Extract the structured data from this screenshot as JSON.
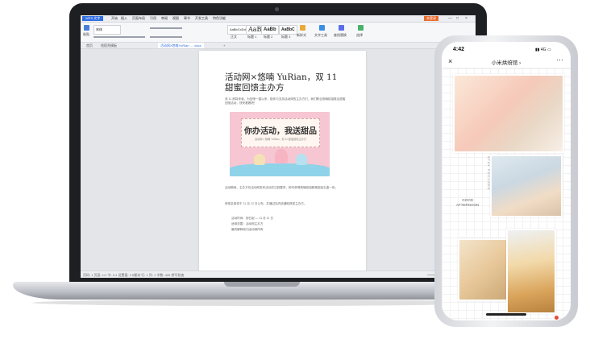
{
  "laptop": {
    "app_tab": "WPS 文字",
    "menu": [
      "开始",
      "插入",
      "页面布局",
      "引用",
      "审阅",
      "视图",
      "章节",
      "开发工具",
      "特色功能"
    ],
    "active_menu": "开始",
    "login": "未登录",
    "window_controls": [
      "—",
      "□",
      "×"
    ],
    "ribbon": {
      "paste": "粘贴",
      "font_name": "宋体",
      "styles": [
        {
          "sample": "AaBbCcDd",
          "label": "正文"
        },
        {
          "sample": "AaB",
          "label": "标题 1"
        },
        {
          "sample": "AaBb",
          "label": "标题 2"
        },
        {
          "sample": "AaBbC",
          "label": "标题 3"
        }
      ],
      "new_style": "新样式",
      "text_tools": "文字工具",
      "find_replace": "查找替换",
      "select": "选择"
    },
    "doc_tabs": [
      "首页",
      "找稻壳模板",
      "活动网X悠唯YuRian ... .docx",
      "+"
    ],
    "document": {
      "title": "活动网×悠喃 YuRian，双 11 甜蜜回馈主办方",
      "intro": "双 11 即将来临，为回馈一直以来，陪伴与支持活动网的主办方们，我们联合悠喃烘焙推出甜蜜回馈活动，快来看看吧！",
      "banner_title": "你办活动，我送甜品",
      "banner_sub": "活动网 x 悠喃 YuRian，双 11 甜蜜回馈主办方",
      "body": [
        "活动期间，主办方在活动网发布活动并达到要求，即可获得悠喃烘焙精美甜品礼盒一份。",
        "获奖名单将于 11 月 12 日公布，并通过站内信通知获奖主办方。",
        "活动时间：即日起 — 11 月 11 日",
        "适用范围：活动网主办方",
        "最终解释权归活动网所有"
      ]
    },
    "status": "页码: 1  页面: 1/1  节: 1/1  设置值: 2.5厘米  行: 1  列: 1  字数: 426  拼写检查"
  },
  "phone": {
    "time": "4:42",
    "status_icons": "▮▮ 4G ▭",
    "title": "小米烘焙馆 ›",
    "close": "×",
    "more": "···",
    "vertical_text": "STAY FOCUSED",
    "good_afternoon": [
      "GOOD",
      "AFTERNOON"
    ]
  }
}
